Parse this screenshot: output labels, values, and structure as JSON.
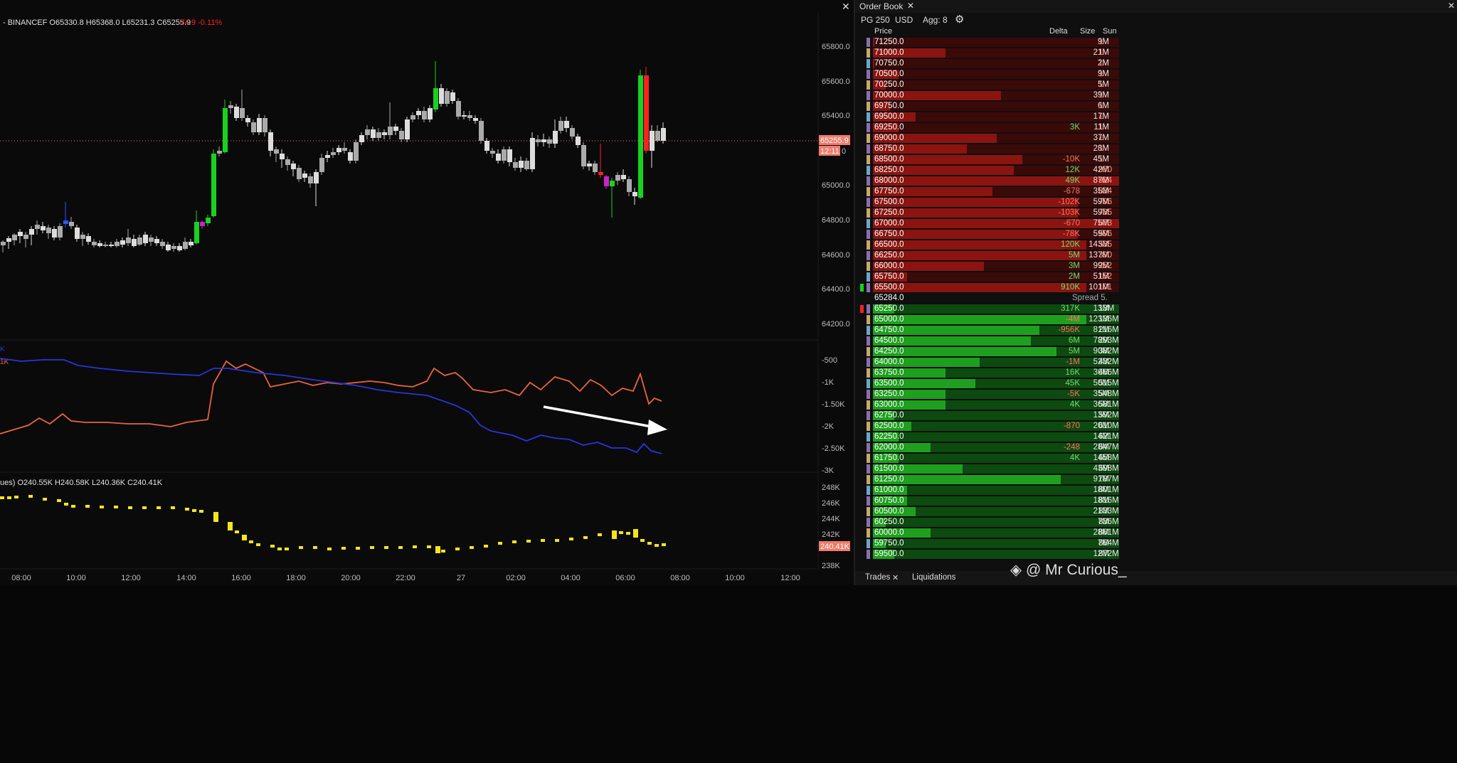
{
  "chart": {
    "ohlc_label": "- BINANCEF O65330.8 H65368.0 L65231.3 C65255.9",
    "change_label": "-74.9 -0.11%",
    "price_axis": [
      "65800.0",
      "65600.0",
      "65400.0",
      "65000.0",
      "64800.0",
      "64600.0",
      "64400.0",
      "64200.0"
    ],
    "current_price": "65255.9",
    "countdown": "12:11",
    "indicator_axis": [
      "-500",
      "-1K",
      "-1.50K",
      "-2K",
      "-2.50K",
      "-3K"
    ],
    "indicator_labels": [
      "K",
      "1K"
    ],
    "volume_label": "ues) O240.55K H240.58K L240.36K C240.41K",
    "volume_axis": [
      "248K",
      "246K",
      "244K",
      "242K",
      "238K"
    ],
    "volume_current": "240.41K",
    "time_axis": [
      "08:00",
      "10:00",
      "12:00",
      "14:00",
      "16:00",
      "18:00",
      "20:00",
      "22:00",
      "27",
      "02:00",
      "04:00",
      "06:00",
      "08:00",
      "10:00",
      "12:00"
    ],
    "colors": {
      "up": "#19d11f",
      "down": "#ff2020",
      "neutral": "#d8d8d8",
      "orange": "#e8643c",
      "blue": "#2a35d8",
      "yellow": "#f5e51c",
      "price_tag": "#f07c6c"
    }
  },
  "order_book": {
    "tab_title": "Order Book",
    "toolbar": {
      "pg": "PG 250",
      "currency": "USD",
      "agg": "Agg: 8"
    },
    "headers": {
      "price": "Price",
      "delta": "Delta",
      "size": "Size",
      "sum": "Sun"
    },
    "asks": [
      {
        "price": "71250.0",
        "delta": "",
        "size": "9M",
        "sum": "1",
        "bar": 0
      },
      {
        "price": "71000.0",
        "delta": "",
        "size": "21M",
        "sum": "1",
        "bar": 0.34
      },
      {
        "price": "70750.0",
        "delta": "",
        "size": "2M",
        "sum": "1",
        "bar": 0
      },
      {
        "price": "70500.0",
        "delta": "",
        "size": "9M",
        "sum": "1",
        "bar": 0.12
      },
      {
        "price": "70250.0",
        "delta": "",
        "size": "5M",
        "sum": "1",
        "bar": 0.06
      },
      {
        "price": "70000.0",
        "delta": "",
        "size": "39M",
        "sum": "1",
        "bar": 0.6
      },
      {
        "price": "69750.0",
        "delta": "",
        "size": "6M",
        "sum": "1",
        "bar": 0.08
      },
      {
        "price": "69500.0",
        "delta": "",
        "size": "17M",
        "sum": "1",
        "bar": 0.2
      },
      {
        "price": "69250.0",
        "delta": "3K",
        "size": "11M",
        "sum": "1",
        "bar": 0.12
      },
      {
        "price": "69000.0",
        "delta": "",
        "size": "37M",
        "sum": "1",
        "bar": 0.58
      },
      {
        "price": "68750.0",
        "delta": "",
        "size": "28M",
        "sum": "1",
        "bar": 0.44
      },
      {
        "price": "68500.0",
        "delta": "-10K",
        "size": "45M",
        "sum": "1",
        "bar": 0.7
      },
      {
        "price": "68250.0",
        "delta": "12K",
        "size": "42M",
        "sum": "970",
        "bar": 0.66
      },
      {
        "price": "68000.0",
        "delta": "49K",
        "size": "87M",
        "sum": "924",
        "bar": 1.4
      },
      {
        "price": "67750.0",
        "delta": "-678",
        "size": "35M",
        "sum": "834",
        "bar": 0.56
      },
      {
        "price": "67500.0",
        "delta": "-102K",
        "size": "59M",
        "sum": "796",
        "bar": 0.96
      },
      {
        "price": "67250.0",
        "delta": "-103K",
        "size": "59M",
        "sum": "735",
        "bar": 0.96
      },
      {
        "price": "67000.0",
        "delta": "-670",
        "size": "75M",
        "sum": "673",
        "bar": 1.2
      },
      {
        "price": "66750.0",
        "delta": "-78K",
        "size": "59M",
        "sum": "596",
        "bar": 0.96
      },
      {
        "price": "66500.0",
        "delta": "120K",
        "size": "143M",
        "sum": "535",
        "bar": 1.0
      },
      {
        "price": "66250.0",
        "delta": "5M",
        "size": "137M",
        "sum": "390",
        "bar": 1.0
      },
      {
        "price": "66000.0",
        "delta": "3M",
        "size": "99M",
        "sum": "252",
        "bar": 0.52
      },
      {
        "price": "65750.0",
        "delta": "2M",
        "size": "51M",
        "sum": "152",
        "bar": 0.16
      },
      {
        "price": "65500.0",
        "delta": "910K",
        "size": "101M",
        "sum": "101",
        "bar": 1.0
      }
    ],
    "spread": {
      "price": "65284.0",
      "label": "Spread 5."
    },
    "bids": [
      {
        "price": "65250.0",
        "delta": "317K",
        "size": "13M",
        "sum": "13M",
        "bar": 0.1
      },
      {
        "price": "65000.0",
        "delta": "-4M",
        "size": "123M",
        "sum": "136M",
        "bar": 1.0
      },
      {
        "price": "64750.0",
        "delta": "-956K",
        "size": "81M",
        "sum": "216M",
        "bar": 0.78
      },
      {
        "price": "64500.0",
        "delta": "6M",
        "size": "78M",
        "sum": "293M",
        "bar": 0.74
      },
      {
        "price": "64250.0",
        "delta": "5M",
        "size": "90M",
        "sum": "382M",
        "bar": 0.86
      },
      {
        "price": "64000.0",
        "delta": "-1M",
        "size": "52M",
        "sum": "432M",
        "bar": 0.5
      },
      {
        "price": "63750.0",
        "delta": "16K",
        "size": "36M",
        "sum": "466M",
        "bar": 0.34
      },
      {
        "price": "63500.0",
        "delta": "45K",
        "size": "50M",
        "sum": "515M",
        "bar": 0.48
      },
      {
        "price": "63250.0",
        "delta": "-5K",
        "size": "35M",
        "sum": "548M",
        "bar": 0.34
      },
      {
        "price": "63000.0",
        "delta": "4K",
        "size": "36M",
        "sum": "581M",
        "bar": 0.34
      },
      {
        "price": "62750.0",
        "delta": "",
        "size": "13M",
        "sum": "592M",
        "bar": 0.1
      },
      {
        "price": "62500.0",
        "delta": "-870",
        "size": "20M",
        "sum": "610M",
        "bar": 0.18
      },
      {
        "price": "62250.0",
        "delta": "",
        "size": "14M",
        "sum": "621M",
        "bar": 0.12
      },
      {
        "price": "62000.0",
        "delta": "-248",
        "size": "28M",
        "sum": "647M",
        "bar": 0.27
      },
      {
        "price": "61750.0",
        "delta": "4K",
        "size": "14M",
        "sum": "658M",
        "bar": 0.12
      },
      {
        "price": "61500.0",
        "delta": "",
        "size": "43M",
        "sum": "698M",
        "bar": 0.42
      },
      {
        "price": "61250.0",
        "delta": "",
        "size": "91M",
        "sum": "787M",
        "bar": 0.88
      },
      {
        "price": "61000.0",
        "delta": "",
        "size": "18M",
        "sum": "801M",
        "bar": 0.16
      },
      {
        "price": "60750.0",
        "delta": "",
        "size": "18M",
        "sum": "816M",
        "bar": 0.16
      },
      {
        "price": "60500.0",
        "delta": "",
        "size": "21M",
        "sum": "833M",
        "bar": 0.2
      },
      {
        "price": "60250.0",
        "delta": "",
        "size": "7M",
        "sum": "836M",
        "bar": 0.06
      },
      {
        "price": "60000.0",
        "delta": "",
        "size": "28M",
        "sum": "861M",
        "bar": 0.27
      },
      {
        "price": "59750.0",
        "delta": "",
        "size": "7M",
        "sum": "864M",
        "bar": 0.06
      },
      {
        "price": "59500.0",
        "delta": "",
        "size": "12M",
        "sum": "872M",
        "bar": 0.1
      }
    ],
    "bottom_tabs": {
      "trades": "Trades",
      "liquidations": "Liquidations"
    },
    "colors": {
      "ask": "#8b1410",
      "ask_dark": "#3a0a08",
      "bid": "#1ea01e",
      "bid_dark": "#0c4a10"
    }
  },
  "watermark": "@ Mr Curious_"
}
